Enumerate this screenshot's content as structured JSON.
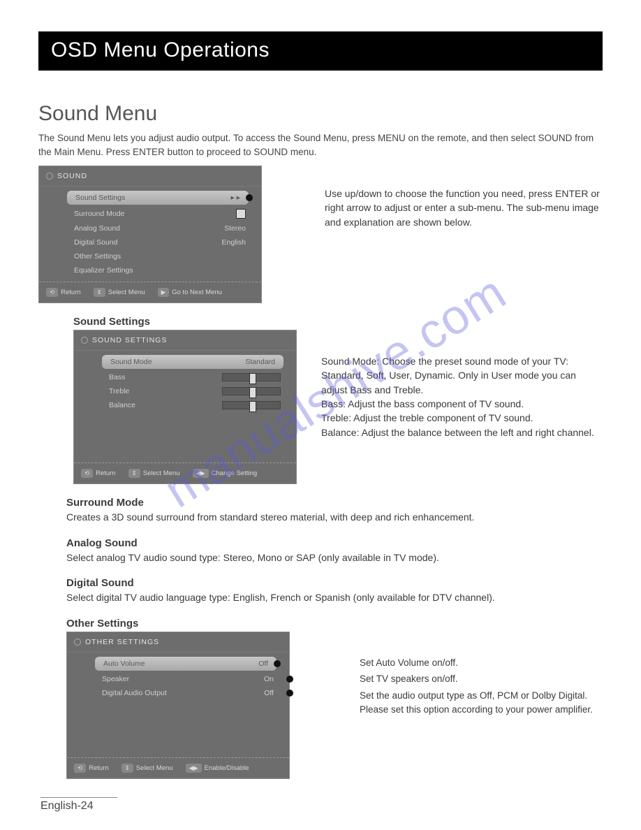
{
  "header": {
    "title": "OSD Menu Operations"
  },
  "section": {
    "title": "Sound Menu",
    "intro": "The Sound Menu lets you adjust audio output. To access the Sound Menu, press MENU on the remote, and then select SOUND from the Main Menu. Press ENTER button to proceed to SOUND menu."
  },
  "osd1": {
    "title": "SOUND",
    "items": [
      {
        "label": "Sound Settings",
        "value": "▸ ▸",
        "sel": true
      },
      {
        "label": "Surround Mode",
        "value": "☐"
      },
      {
        "label": "Analog Sound",
        "value": "Stereo"
      },
      {
        "label": "Digital Sound",
        "value": "English"
      },
      {
        "label": "Other Settings",
        "value": ""
      },
      {
        "label": "Equalizer Settings",
        "value": ""
      }
    ],
    "foot": [
      "Return",
      "Select Menu",
      "Go to Next Menu"
    ],
    "annotation": "Use up/down to choose the function you need, press ENTER or right arrow to adjust or enter a sub-menu. The sub-menu image and explanation are shown below."
  },
  "soundSettings": {
    "heading": "Sound Settings",
    "osdTitle": "SOUND SETTINGS",
    "items": [
      {
        "label": "Sound Mode",
        "value": "Standard",
        "sel": true
      },
      {
        "label": "Bass",
        "type": "slider"
      },
      {
        "label": "Treble",
        "type": "slider"
      },
      {
        "label": "Balance",
        "type": "slider"
      }
    ],
    "foot": [
      "Return",
      "Select Menu",
      "Change Setting"
    ],
    "desc": "Sound Mode: Choose the preset sound mode of your TV: Standard, Soft, User, Dynamic. Only in User mode you can adjust Bass and Treble.\nBass: Adjust the bass component of TV sound.\nTreble: Adjust the treble component of TV sound.\nBalance: Adjust the balance between the left and right channel."
  },
  "surround": {
    "heading": "Surround Mode",
    "text": "Creates a 3D sound surround from standard stereo material, with deep and rich enhancement."
  },
  "analog": {
    "heading": "Analog Sound",
    "text": "Select analog TV audio sound type: Stereo, Mono or SAP (only available in TV mode)."
  },
  "digital": {
    "heading": "Digital Sound",
    "text": "Select digital TV audio language type: English, French or Spanish (only available for DTV channel)."
  },
  "other": {
    "heading": "Other Settings",
    "osdTitle": "OTHER SETTINGS",
    "items": [
      {
        "label": "Auto Volume",
        "value": "Off",
        "sel": true
      },
      {
        "label": "Speaker",
        "value": "On"
      },
      {
        "label": "Digital Audio Output",
        "value": "Off"
      }
    ],
    "foot": [
      "Return",
      "Select Menu",
      "Enable/Disable"
    ],
    "annotations": [
      "Set Auto Volume on/off.",
      "Set TV speakers on/off.",
      "Set the audio output type as Off, PCM or Dolby Digital. Please set this option according to your power amplifier."
    ]
  },
  "pageFooter": "English-24",
  "watermark": "manualshive.com"
}
